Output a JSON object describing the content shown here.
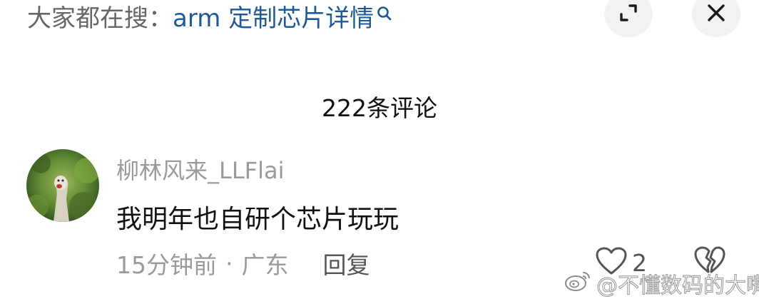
{
  "search": {
    "prefix": "大家都在搜：",
    "query": "arm 定制芯片详情"
  },
  "comments_title": "222条评论",
  "comment": {
    "username": "柳林风来_LLFlai",
    "text": "我明年也自研个芯片玩玩",
    "time": "15分钟前",
    "separator": "·",
    "location": "广东",
    "reply_label": "回复",
    "like_count": "2"
  },
  "watermark": {
    "text": "@不懂数码的大嘴"
  },
  "icons": {
    "expand": "expand-icon",
    "close": "close-icon",
    "search": "search-icon",
    "like": "heart-outline-icon",
    "dislike": "broken-heart-icon",
    "watermark": "weibo-logo-icon"
  },
  "colors": {
    "query_link": "#1f5a96",
    "secondary_text": "#9a9a9a",
    "primary_text": "#111111",
    "button_bg": "#f2f2f2"
  }
}
